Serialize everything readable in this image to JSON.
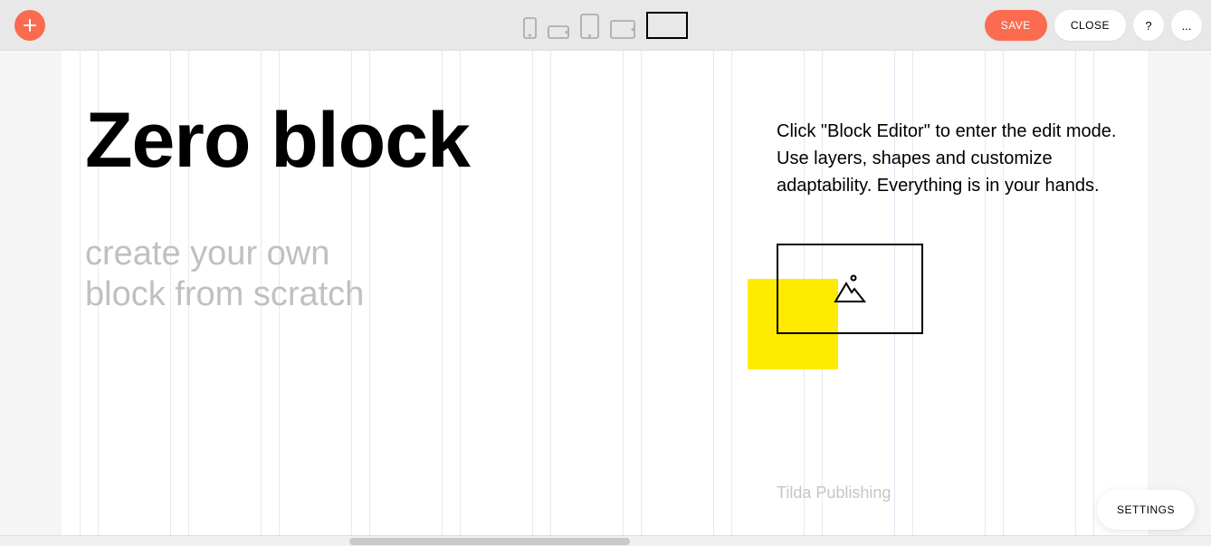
{
  "toolbar": {
    "save_label": "SAVE",
    "close_label": "CLOSE",
    "help_label": "?",
    "more_label": "..."
  },
  "devices": {
    "items": [
      "phone-portrait",
      "phone-landscape",
      "tablet-portrait",
      "tablet-landscape",
      "desktop"
    ],
    "active": "desktop"
  },
  "content": {
    "title": "Zero block",
    "subtitle": "create your own\nblock from scratch",
    "description": "Click \"Block Editor\" to enter the edit mode. Use layers, shapes and customize adaptability. Everything is in your hands.",
    "credit": "Tilda Publishing"
  },
  "settings_label": "SETTINGS",
  "colors": {
    "accent": "#fa6b50",
    "yellow": "#ffeb00",
    "muted": "#c0c0c0"
  }
}
